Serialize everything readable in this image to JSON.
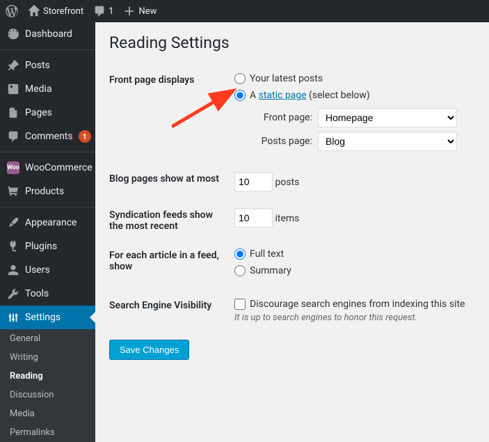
{
  "adminbar": {
    "site_name": "Storefront",
    "comments_count": "1",
    "new_label": "New"
  },
  "sidebar": {
    "dashboard": "Dashboard",
    "posts": "Posts",
    "media": "Media",
    "pages": "Pages",
    "comments": "Comments",
    "comments_badge": "1",
    "woocommerce": "WooCommerce",
    "products": "Products",
    "appearance": "Appearance",
    "plugins": "Plugins",
    "users": "Users",
    "tools": "Tools",
    "settings": "Settings",
    "sub": {
      "general": "General",
      "writing": "Writing",
      "reading": "Reading",
      "discussion": "Discussion",
      "media": "Media",
      "permalinks": "Permalinks"
    }
  },
  "page": {
    "title": "Reading Settings",
    "front_page_displays": "Front page displays",
    "latest_posts": "Your latest posts",
    "a_prefix": "A ",
    "static_page_link": "static page",
    "select_below": " (select below)",
    "front_page_label": "Front page:",
    "posts_page_label": "Posts page:",
    "front_page_value": "Homepage",
    "posts_page_value": "Blog",
    "blog_pages_label": "Blog pages show at most",
    "blog_pages_value": "10",
    "blog_pages_unit": "posts",
    "syndication_label": "Syndication feeds show the most recent",
    "syndication_value": "10",
    "syndication_unit": "items",
    "article_feed_label": "For each article in a feed, show",
    "full_text": "Full text",
    "summary": "Summary",
    "seo_label": "Search Engine Visibility",
    "seo_checkbox": "Discourage search engines from indexing this site",
    "seo_desc": "It is up to search engines to honor this request.",
    "save": "Save Changes"
  }
}
